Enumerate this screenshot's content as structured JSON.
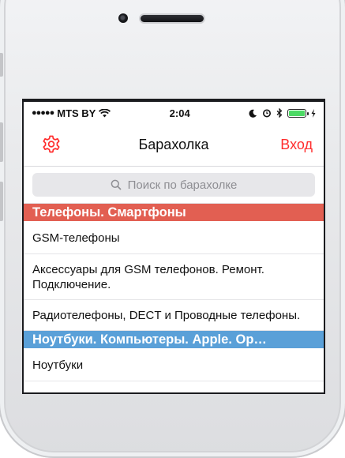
{
  "status": {
    "carrier": "MTS BY",
    "signal_dots": "●●●●●",
    "time": "2:04"
  },
  "nav": {
    "title": "Барахолка",
    "login_label": "Вход",
    "accent_color": "#ff2d2d"
  },
  "search": {
    "placeholder": "Поиск по барахолке"
  },
  "sections": [
    {
      "title": "Телефоны. Смартфоны",
      "color": "#e25f52",
      "items": [
        "GSM-телефоны",
        "Аксессуары для GSM телефонов. Ремонт. Подключение.",
        "Радиотелефоны, DECT и Проводные телефоны."
      ]
    },
    {
      "title": "Ноутбуки. Компьютеры. Apple. Ор…",
      "color": "#5aa0d8",
      "items": [
        "Ноутбуки"
      ]
    }
  ]
}
